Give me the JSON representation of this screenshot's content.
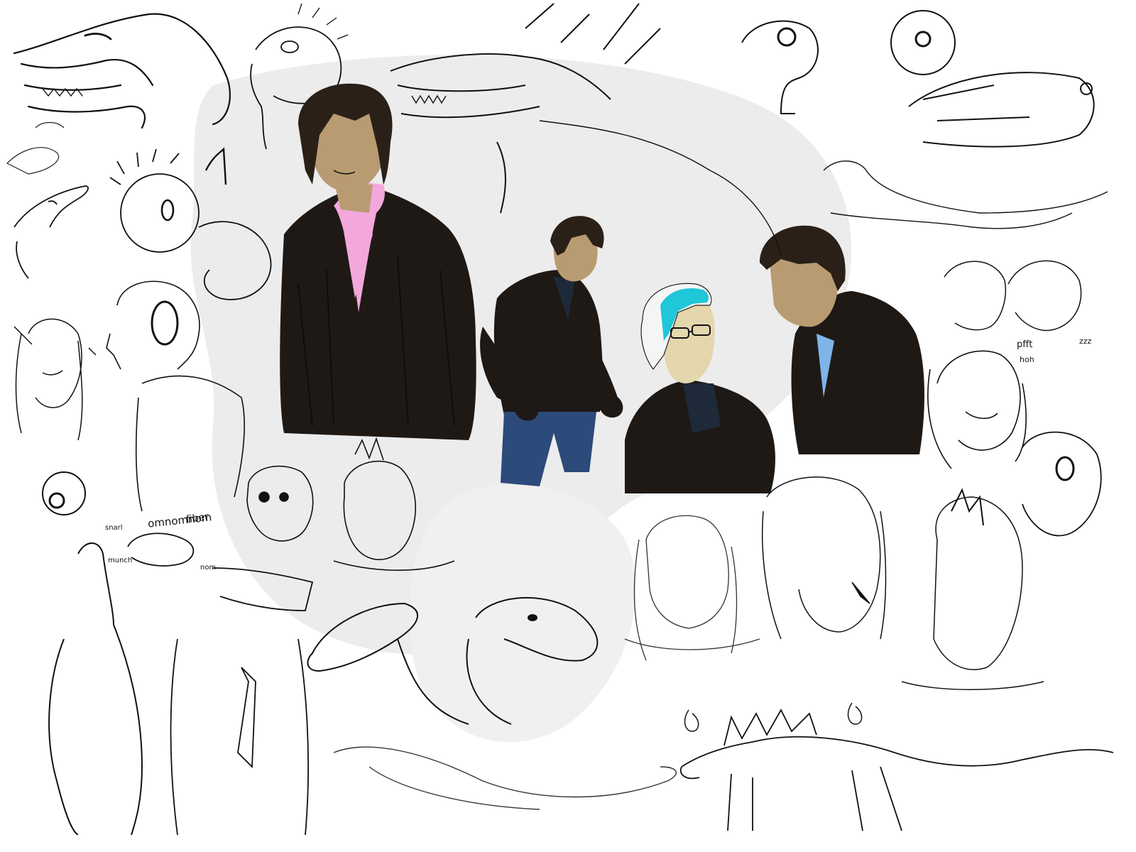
{
  "image": {
    "background_color": "#ffffff",
    "watermark_color": "#e9e9e9",
    "line_color": "#111111"
  },
  "scribbles": {
    "omnomnom": "omnomnom",
    "fiber": "fiber",
    "pfft": "pfft",
    "hoh": "hoh",
    "zzz": "zzz",
    "munch": "munch",
    "nom": "nom",
    "snarl": "snarl"
  },
  "colors": {
    "jacket": "#1e1915",
    "skin": "#b99b72",
    "hair": "#2a2018",
    "pink_shirt": "#f3a8dc",
    "blue_shirt": "#7fb4e8",
    "navy_shirt": "#1e2a3a",
    "jeans": "#2c4a7a",
    "cyan_hair": "#1fc7d9",
    "pale_skin": "#e4d6ad"
  }
}
